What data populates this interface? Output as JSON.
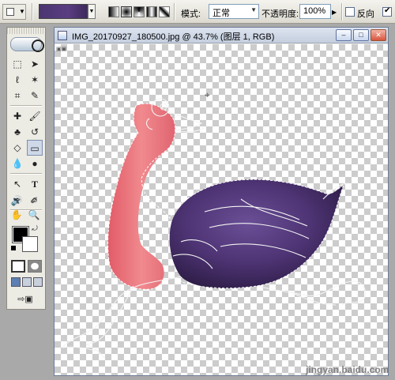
{
  "options_bar": {
    "mode_label": "模式:",
    "mode_value": "正常",
    "opacity_label": "不透明度:",
    "opacity_value": "100%",
    "reverse_label": "反向",
    "reverse_checked": false,
    "dither_checked": true,
    "gradient_colors": [
      "#4a3570",
      "#5a3d82",
      "#3d2a5c"
    ]
  },
  "tools_panel": {
    "foreground_color": "#000000",
    "background_color": "#ffffff",
    "tools": [
      "marquee-icon",
      "move-icon",
      "lasso-icon",
      "magic-wand-icon",
      "crop-icon",
      "slice-icon",
      "healing-brush-icon",
      "brush-icon",
      "clone-stamp-icon",
      "history-brush-icon",
      "eraser-icon",
      "gradient-icon",
      "blur-icon",
      "dodge-icon",
      "path-selection-icon",
      "type-icon",
      "pen-icon",
      "shape-icon",
      "notes-icon",
      "eyedropper-icon",
      "hand-icon",
      "zoom-icon"
    ],
    "active_tool": "gradient-icon"
  },
  "document": {
    "title": "IMG_20170927_180500.jpg @ 43.7% (图层 1, RGB)",
    "minimize_label": "–",
    "maximize_label": "□",
    "close_label": "✕"
  },
  "watermark": "jingyan.baidu.com",
  "colors": {
    "neck_pink": "#e8737a",
    "body_purple": "#4e3474",
    "selection_outline": "#ffffff"
  }
}
